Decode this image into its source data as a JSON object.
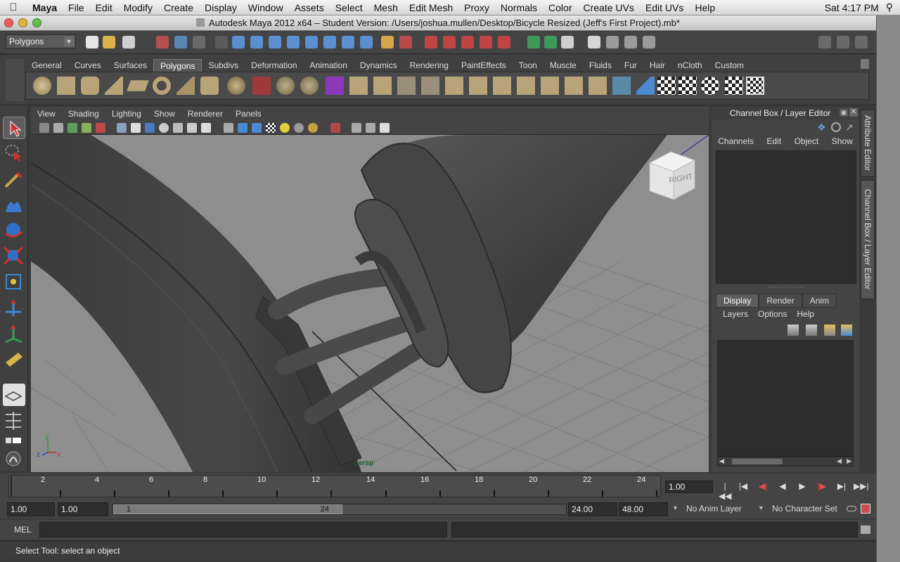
{
  "menubar": {
    "app_name": "Maya",
    "items": [
      "File",
      "Edit",
      "Modify",
      "Create",
      "Display",
      "Window",
      "Assets",
      "Select",
      "Mesh",
      "Edit Mesh",
      "Proxy",
      "Normals",
      "Color",
      "Create UVs",
      "Edit UVs",
      "Help"
    ],
    "clock": "Sat 4:17 PM"
  },
  "window": {
    "title": "Autodesk Maya 2012 x64 – Student Version: /Users/joshua.mullen/Desktop/Bicycle Resized (Jeff's First Project).mb*"
  },
  "status_line": {
    "mode": "Polygons"
  },
  "shelf": {
    "tabs": [
      "General",
      "Curves",
      "Surfaces",
      "Polygons",
      "Subdivs",
      "Deformation",
      "Animation",
      "Dynamics",
      "Rendering",
      "PaintEffects",
      "Toon",
      "Muscle",
      "Fluids",
      "Fur",
      "Hair",
      "nCloth",
      "Custom"
    ],
    "active_tab": "Polygons"
  },
  "panel": {
    "menus": [
      "View",
      "Shading",
      "Lighting",
      "Show",
      "Renderer",
      "Panels"
    ],
    "camera": "persp",
    "view_cube": "RIGHT"
  },
  "channel_box": {
    "title": "Channel Box / Layer Editor",
    "menus": [
      "Channels",
      "Edit",
      "Object",
      "Show"
    ]
  },
  "layer_editor": {
    "tabs": [
      "Display",
      "Render",
      "Anim"
    ],
    "active_tab": "Display",
    "menus": [
      "Layers",
      "Options",
      "Help"
    ]
  },
  "side_tabs": [
    "Attribute Editor",
    "Channel Box / Layer Editor"
  ],
  "time_slider": {
    "ticks": [
      "2",
      "4",
      "6",
      "8",
      "10",
      "12",
      "14",
      "16",
      "18",
      "20",
      "22",
      "24"
    ],
    "current_frame": "1.00"
  },
  "range_slider": {
    "start_time": "1.00",
    "playback_start": "1.00",
    "range_min": "1",
    "range_max": "24",
    "playback_end": "24.00",
    "end_time": "48.00",
    "anim_layer": "No Anim Layer",
    "character_set": "No Character Set"
  },
  "command_line": {
    "label": "MEL"
  },
  "help_line": {
    "text": "Select Tool: select an object"
  },
  "colors": {
    "ui_bg": "#444444",
    "viewport_bg": "#8e8e8e",
    "model": "#3f3f3f",
    "grid": "#777777"
  }
}
